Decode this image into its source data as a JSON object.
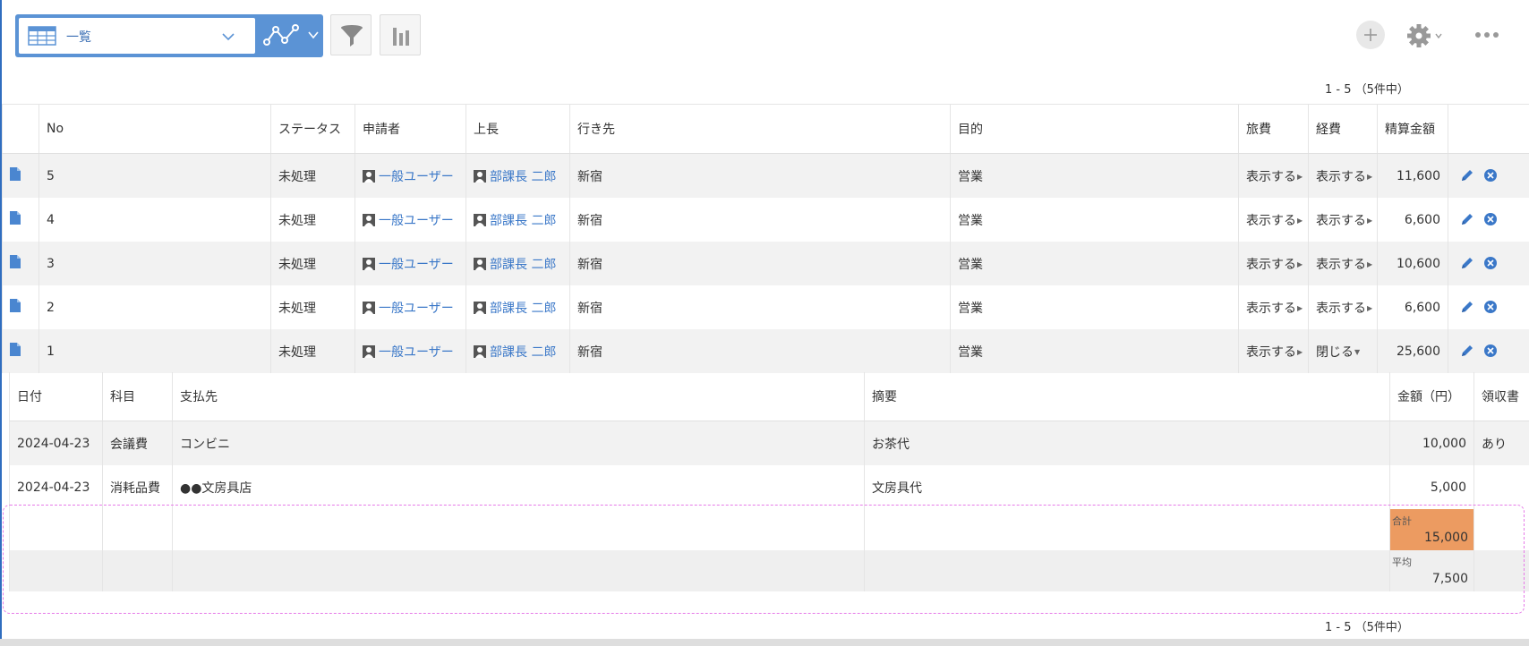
{
  "toolbar": {
    "view_selected": "一覧",
    "icons": [
      "table-grid-icon",
      "chevron-down-icon",
      "graph-line-icon",
      "filter-icon",
      "bar-chart-icon",
      "plus-icon",
      "gear-icon",
      "more-icon"
    ]
  },
  "pager": {
    "top": "1 - 5 （5件中）",
    "bottom": "1 - 5 （5件中）"
  },
  "main_table": {
    "headers": [
      "",
      "No",
      "ステータス",
      "申請者",
      "上長",
      "行き先",
      "目的",
      "旅費",
      "経費",
      "精算金額",
      ""
    ],
    "rows": [
      {
        "no": "5",
        "status": "未処理",
        "applicant": "一般ユーザー",
        "boss": "部課長 二郎",
        "destination": "新宿",
        "purpose": "営業",
        "travel": "表示する",
        "expense": "表示する",
        "amount": "11,600"
      },
      {
        "no": "4",
        "status": "未処理",
        "applicant": "一般ユーザー",
        "boss": "部課長 二郎",
        "destination": "新宿",
        "purpose": "営業",
        "travel": "表示する",
        "expense": "表示する",
        "amount": "6,600"
      },
      {
        "no": "3",
        "status": "未処理",
        "applicant": "一般ユーザー",
        "boss": "部課長 二郎",
        "destination": "新宿",
        "purpose": "営業",
        "travel": "表示する",
        "expense": "表示する",
        "amount": "10,600"
      },
      {
        "no": "2",
        "status": "未処理",
        "applicant": "一般ユーザー",
        "boss": "部課長 二郎",
        "destination": "新宿",
        "purpose": "営業",
        "travel": "表示する",
        "expense": "表示する",
        "amount": "6,600"
      },
      {
        "no": "1",
        "status": "未処理",
        "applicant": "一般ユーザー",
        "boss": "部課長 二郎",
        "destination": "新宿",
        "purpose": "営業",
        "travel": "表示する",
        "expense": "閉じる",
        "amount": "25,600"
      }
    ]
  },
  "sub_table": {
    "headers": [
      "日付",
      "科目",
      "支払先",
      "摘要",
      "金額（円）",
      "領収書"
    ],
    "rows": [
      {
        "date": "2024-04-23",
        "category": "会議費",
        "payee": "コンビニ",
        "note": "お茶代",
        "amount": "10,000",
        "receipt": "あり"
      },
      {
        "date": "2024-04-23",
        "category": "消耗品費",
        "payee": "●●文房具店",
        "note": "文房具代",
        "amount": "5,000",
        "receipt": ""
      }
    ],
    "summary": {
      "total_label": "合計",
      "total_value": "15,000",
      "avg_label": "平均",
      "avg_value": "7,500"
    }
  },
  "colors": {
    "accent": "#5b93d5",
    "link": "#3b78c8",
    "highlight": "#ec9b61",
    "selection": "#e67ae8"
  }
}
